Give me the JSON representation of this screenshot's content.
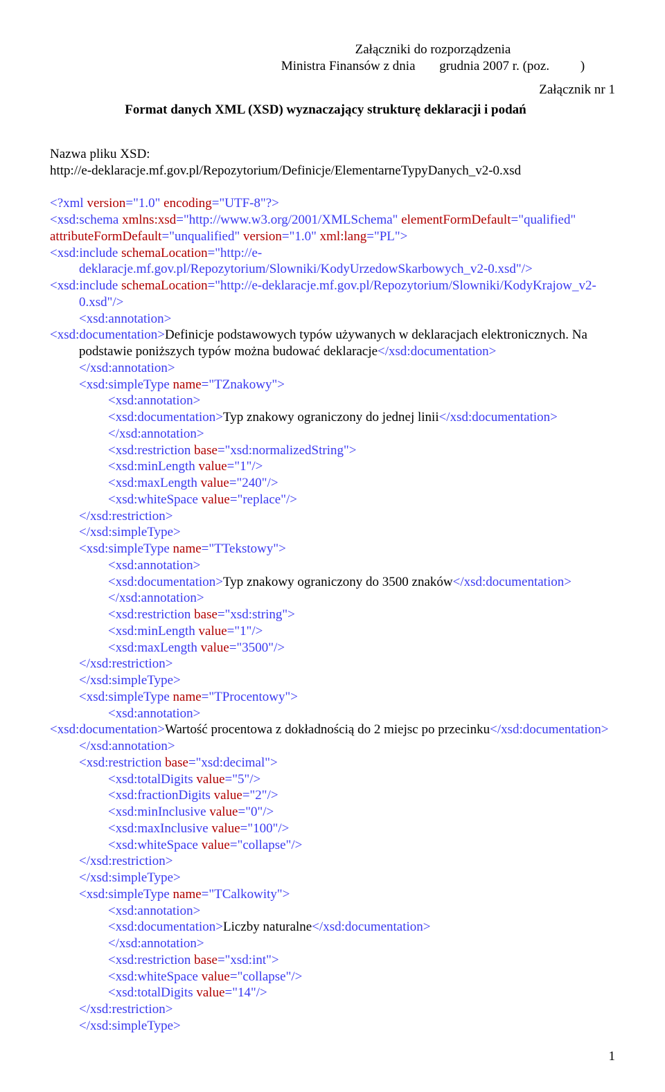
{
  "header": {
    "l1": "Załączniki do rozporządzenia",
    "l2a": "Ministra Finansów z dnia",
    "l2b": "grudnia 2007 r. (poz.",
    "l2c": ")",
    "attach": "Załącznik nr 1",
    "title": "Format danych XML (XSD) wyznaczający strukturę deklaracji i podań"
  },
  "intro": {
    "label": "Nazwa pliku XSD:",
    "url": "http://e-deklaracje.mf.gov.pl/Repozytorium/Definicje/ElementarneTypyDanych_v2-0.xsd"
  },
  "x": {
    "decl_open": "<?xml ",
    "decl_v_a": "version",
    "decl_v_v": "\"1.0\"",
    "decl_e_a": "encoding",
    "decl_e_v": "\"UTF-8\"",
    "decl_close": "?>",
    "schema_open": "<xsd:schema ",
    "xmlns_a": "xmlns:xsd",
    "xmlns_v": "\"http://www.w3.org/2001/XMLSchema\"",
    "efd_a": "elementFormDefault",
    "efd_v": "\"qualified\"",
    "afd_a": "attributeFormDefault",
    "afd_v": "\"unqualified\"",
    "ver_a": "version",
    "ver_v": "\"1.0\"",
    "lang_a": "xml:lang",
    "lang_v": "\"PL\"",
    "gt": ">",
    "incl_open": "<xsd:include ",
    "sl_a": "schemaLocation",
    "incl1_v": "\"http://e-deklaracje.mf.gov.pl/Repozytorium/Slowniki/KodyUrzedowSkarbowych_v2-0.xsd\"",
    "incl2_v": "\"http://e-deklaracje.mf.gov.pl/Repozytorium/Slowniki/KodyKrajow_v2-0.xsd\"",
    "selfclose": "/>",
    "ann_open": "<xsd:annotation>",
    "ann_close": "</xsd:annotation>",
    "doc_open": "<xsd:documentation>",
    "doc_close": "</xsd:documentation>",
    "doc1": "Definicje podstawowych typów używanych w deklaracjach elektronicznych. Na podstawie poniższych typów można budować deklaracje",
    "st_open": "<xsd:simpleType ",
    "name_a": "name",
    "st_close": "</xsd:simpleType>",
    "restr_open": "<xsd:restriction ",
    "base_a": "base",
    "restr_close": "</xsd:restriction>",
    "minL_open": "<xsd:minLength ",
    "maxL_open": "<xsd:maxLength ",
    "ws_open": "<xsd:whiteSpace ",
    "td_open": "<xsd:totalDigits ",
    "fd_open": "<xsd:fractionDigits ",
    "minI_open": "<xsd:minInclusive ",
    "maxI_open": "<xsd:maxInclusive ",
    "value_a": "value",
    "t1_name": "\"TZnakowy\"",
    "t1_doc": "Typ znakowy ograniczony do jednej linii",
    "t1_base": "\"xsd:normalizedString\"",
    "t1_min": "\"1\"",
    "t1_max": "\"240\"",
    "t1_ws": "\"replace\"",
    "t2_name": "\"TTekstowy\"",
    "t2_doc": "Typ znakowy ograniczony do 3500 znaków",
    "t2_base": "\"xsd:string\"",
    "t2_min": "\"1\"",
    "t2_max": "\"3500\"",
    "t3_name": "\"TProcentowy\"",
    "t3_doc": "Wartość procentowa z dokładnością do 2 miejsc po przecinku",
    "t3_base": "\"xsd:decimal\"",
    "t3_td": "\"5\"",
    "t3_fd": "\"2\"",
    "t3_min": "\"0\"",
    "t3_max": "\"100\"",
    "t3_ws": "\"collapse\"",
    "t4_name": "\"TCalkowity\"",
    "t4_doc": "Liczby naturalne",
    "t4_base": "\"xsd:int\"",
    "t4_ws": "\"collapse\"",
    "t4_td": "\"14\""
  },
  "page": "1"
}
